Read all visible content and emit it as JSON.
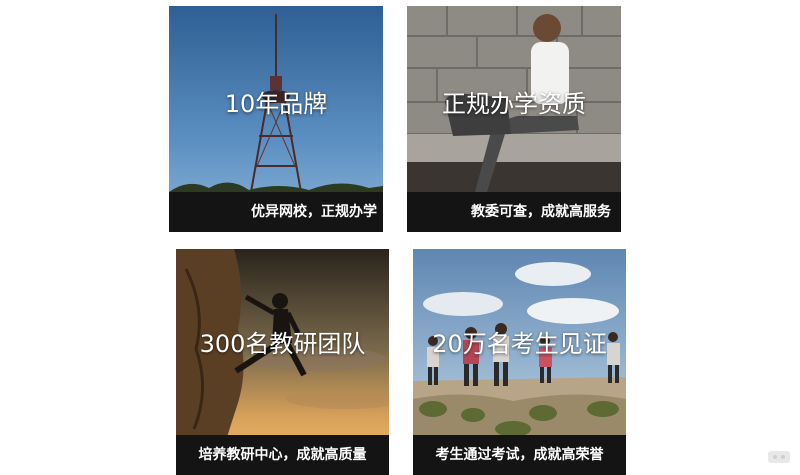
{
  "cards": [
    {
      "title": "10年品牌",
      "caption": "优异网校，正规办学",
      "image": "tv-tower-photo"
    },
    {
      "title": "正规办学资质",
      "caption": "教委可查，成就高服务",
      "image": "woman-sitting-wall-photo"
    },
    {
      "title": "300名教研团队",
      "caption": "培养教研中心，成就高质量",
      "image": "rock-climber-photo"
    },
    {
      "title": "20万名考生见证",
      "caption": "考生通过考试，成就高荣誉",
      "image": "marathon-runners-photo"
    }
  ],
  "colors": {
    "caption_bar": "#141414",
    "caption_text": "#ffffff",
    "title_text": "#ffffff",
    "page_background": "#ffffff"
  }
}
